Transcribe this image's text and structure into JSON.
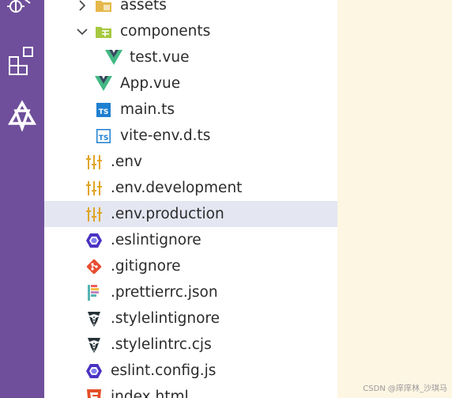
{
  "explorer": {
    "items": [
      {
        "label": "assets",
        "icon": "folder-assets-icon"
      },
      {
        "label": "components",
        "icon": "folder-components-icon"
      },
      {
        "label": "test.vue",
        "icon": "vue-icon"
      },
      {
        "label": "App.vue",
        "icon": "vue-icon"
      },
      {
        "label": "main.ts",
        "icon": "typescript-icon"
      },
      {
        "label": "vite-env.d.ts",
        "icon": "typescript-def-icon"
      },
      {
        "label": ".env",
        "icon": "env-icon"
      },
      {
        "label": ".env.development",
        "icon": "env-icon"
      },
      {
        "label": ".env.production",
        "icon": "env-icon",
        "selected": true
      },
      {
        "label": ".eslintignore",
        "icon": "eslint-icon"
      },
      {
        "label": ".gitignore",
        "icon": "git-icon"
      },
      {
        "label": ".prettierrc.json",
        "icon": "prettier-icon"
      },
      {
        "label": ".stylelintignore",
        "icon": "stylelint-icon"
      },
      {
        "label": ".stylelintrc.cjs",
        "icon": "stylelint-icon"
      },
      {
        "label": "eslint.config.js",
        "icon": "eslint-icon"
      },
      {
        "label": "index.html",
        "icon": "html-icon"
      }
    ]
  },
  "watermark": "CSDN @庠庠林_沙琪马",
  "colors": {
    "activity_bar": "#6f4f9b",
    "selection": "#e4e6f1",
    "editor_bg": "#fdf6e3"
  }
}
